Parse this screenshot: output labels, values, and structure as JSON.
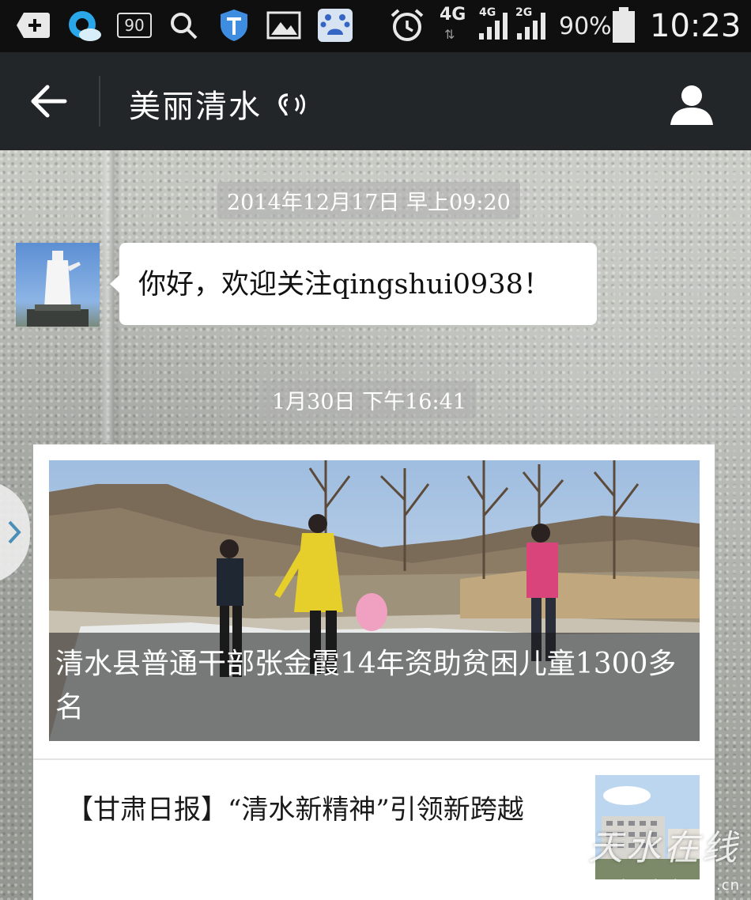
{
  "status_bar": {
    "badge_value": "90",
    "network_4g": "4G",
    "signal_1_label": "4G",
    "signal_2_label": "2G",
    "battery": "90%",
    "time": "10:23"
  },
  "nav": {
    "title": "美丽清水"
  },
  "chat": {
    "messages": [
      {
        "timestamp": "2014年12月17日 早上09:20",
        "text": "你好，欢迎关注qingshui0938！"
      }
    ],
    "article_timestamp": "1月30日 下午16:41",
    "article": {
      "headline": "清水县普通干部张金霞14年资助贫困儿童1300多名",
      "items": [
        {
          "title": "【甘肃日报】“清水新精神”引领新跨越"
        }
      ]
    }
  },
  "watermark": {
    "logo_text": "天水在线",
    "url": "www.tianshui.com.cn"
  },
  "colors": {
    "statusbar": "#0f0f0f",
    "navbar": "#222629",
    "bubble": "#ffffff"
  }
}
